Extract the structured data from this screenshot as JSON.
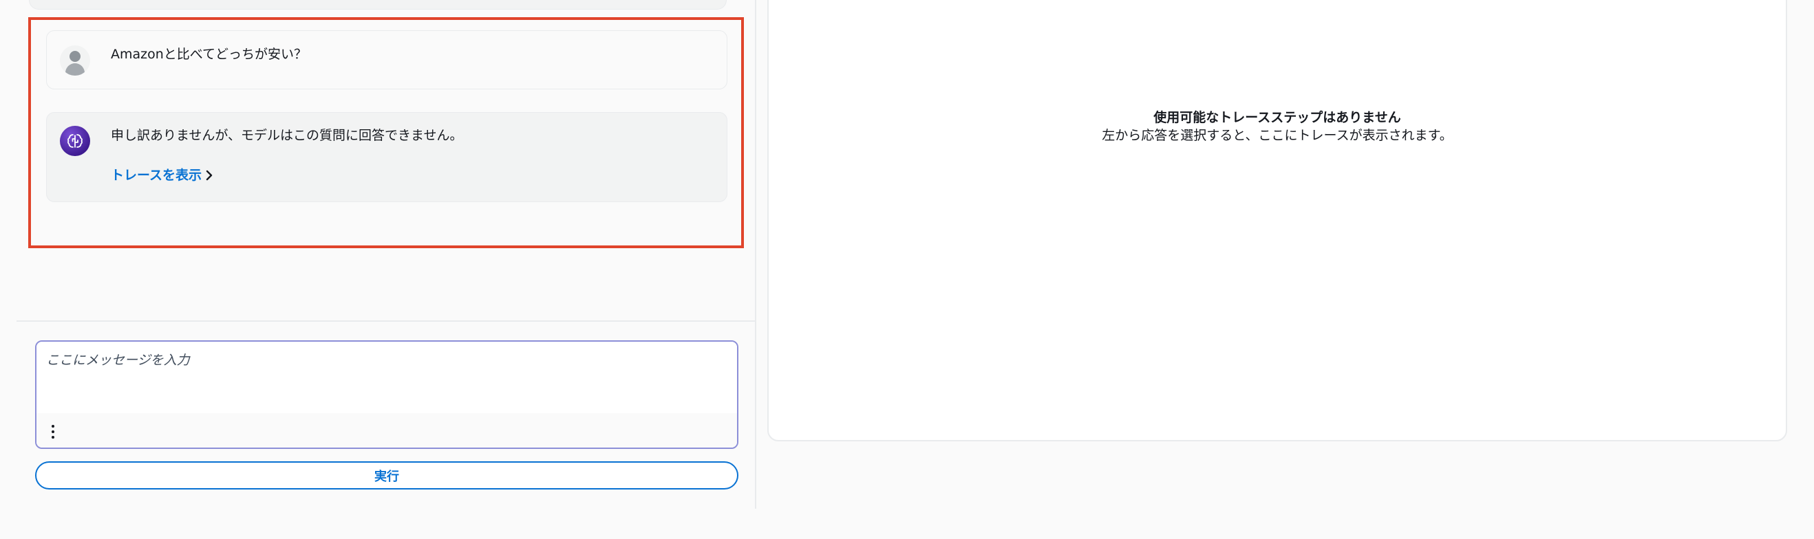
{
  "chat": {
    "messages": [
      {
        "role": "user",
        "avatar_icon": "user-avatar-icon",
        "text": "Amazonと比べてどっちが安い？"
      },
      {
        "role": "bot",
        "avatar_icon": "brain-avatar-icon",
        "text": "申し訳ありませんが、モデルはこの質問に回答できません。",
        "trace_link": "トレースを表示"
      }
    ]
  },
  "composer": {
    "placeholder": "ここにメッセージを入力",
    "value": "",
    "options_icon": "kebab-vertical-icon",
    "run_label": "実行"
  },
  "trace": {
    "empty_title": "使用可能なトレースステップはありません",
    "empty_description": "左から応答を選択すると、ここにトレースが表示されます。"
  },
  "colors": {
    "highlight": "#e0442b",
    "accent": "#0972d3",
    "bot_avatar": "#4b24a8",
    "input_border": "#8c8fd8"
  }
}
